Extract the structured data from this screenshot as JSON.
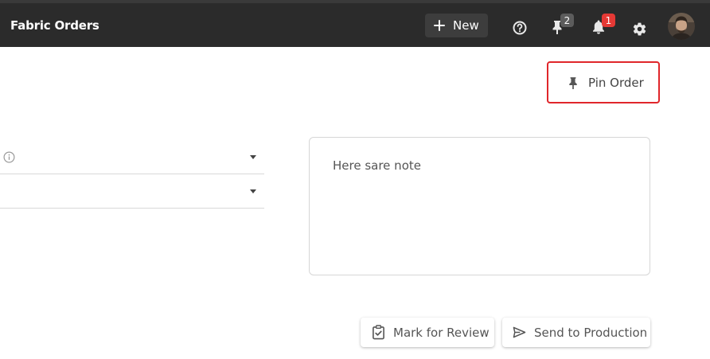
{
  "header": {
    "title": "Fabric Orders",
    "new_label": "New",
    "pinned_count": "2",
    "notification_count": "1"
  },
  "pin_order": {
    "label": "Pin Order"
  },
  "notes": {
    "text": "Here sare note"
  },
  "actions": {
    "mark_review": "Mark for Review",
    "send_production": "Send to Production"
  },
  "colors": {
    "topbar": "#2b2b2b",
    "accent_red": "#e0262b",
    "badge_red": "#e53935",
    "badge_gray": "#5c5c5c"
  },
  "icons": [
    "plus-icon",
    "help-icon",
    "pin-icon",
    "bell-icon",
    "gear-icon",
    "info-icon",
    "chevron-down-icon",
    "clipboard-check-icon",
    "send-icon"
  ]
}
